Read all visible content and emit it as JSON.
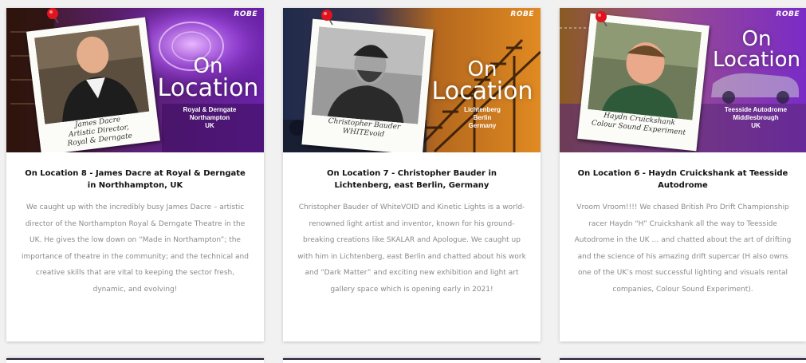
{
  "cards": [
    {
      "brand": "ROBE",
      "heading_word1": "On",
      "heading_word2": "Location",
      "location_lines": [
        "Royal & Derngate",
        "Northampton",
        "UK"
      ],
      "polaroid_caption": [
        "James Dacre",
        "Artistic Director,",
        "Royal & Derngate"
      ],
      "title": "On Location 8 - James Dacre at Royal & Derngate in Northhampton, UK",
      "description": "We caught up with the incredibly busy James Dacre – artistic director of the Northampton Royal & Derngate Theatre in the UK. He gives the low down on “Made in Northampton”; the importance of theatre in the community; and the technical and creative skills that are vital to keeping the sector fresh, dynamic, and evolving!"
    },
    {
      "brand": "ROBE",
      "heading_word1": "On",
      "heading_word2": "Location",
      "location_lines": [
        "Lichtenberg",
        "Berlin",
        "Germany"
      ],
      "polaroid_caption": [
        "Christopher Bauder",
        "WHITEvoid"
      ],
      "title": "On Location 7 - Christopher Bauder in Lichtenberg, east Berlin, Germany",
      "description": "Christopher Bauder of WhiteVOID and Kinetic Lights is a world-renowned light artist and inventor, known for his ground-breaking creations like SKALAR and Apologue. We caught up with him in Lichtenberg, east Berlin and chatted about his work and “Dark Matter” and exciting new exhibition and light art gallery space which is opening early in 2021!"
    },
    {
      "brand": "ROBE",
      "heading_word1": "On",
      "heading_word2": "Location",
      "location_lines": [
        "Teesside Autodrome",
        "Middlesbrough",
        "UK"
      ],
      "polaroid_caption": [
        "Haydn Cruickshank",
        "Colour Sound Experiment"
      ],
      "title": "On Location 6 - Haydn Cruickshank at Teesside Autodrome",
      "description": "Vroom Vroom!!!! We chased British Pro Drift Championship racer Haydn “H” Cruickshank all the way to Teesside Autodrome in the UK … and chatted about the art of drifting and the science of his amazing drift supercar (H also owns one of the UK’s most successful lighting and visuals rental companies, Colour Sound Experiment)."
    }
  ]
}
